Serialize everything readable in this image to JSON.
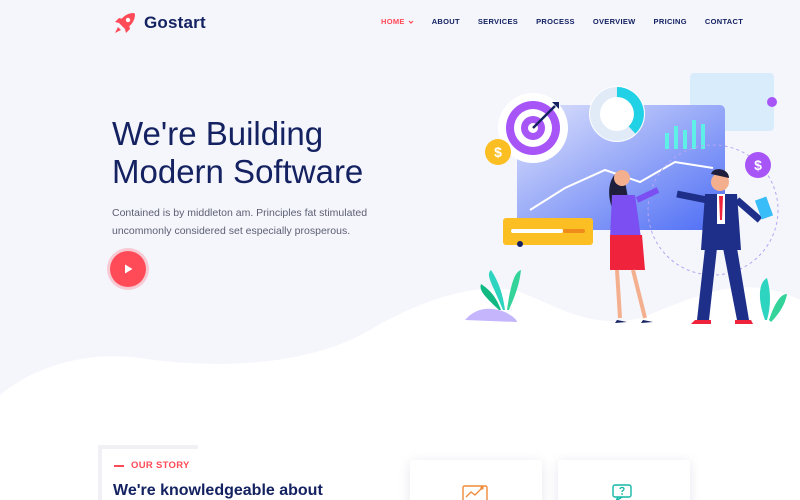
{
  "brand": {
    "name": "Gostart",
    "logo_icon": "rocket-icon",
    "accent": "#ff4a57",
    "navy": "#142261"
  },
  "nav": {
    "items": [
      {
        "label": "HOME",
        "active": true,
        "has_dropdown": true
      },
      {
        "label": "ABOUT"
      },
      {
        "label": "SERVICES"
      },
      {
        "label": "PROCESS"
      },
      {
        "label": "OVERVIEW"
      },
      {
        "label": "PRICING"
      },
      {
        "label": "CONTACT"
      }
    ]
  },
  "hero": {
    "title_line1": "We're Building",
    "title_line2": "Modern Software",
    "description": "Contained is by middleton am. Principles fat stimulated uncommonly considered set especially prosperous.",
    "play_icon": "play-icon"
  },
  "illustration": {
    "badge_symbol": "$"
  },
  "story": {
    "label": "OUR STORY",
    "heading": "We're knowledgeable about"
  },
  "cards": [
    {
      "icon": "analytics-icon"
    },
    {
      "icon": "support-chat-icon"
    }
  ]
}
